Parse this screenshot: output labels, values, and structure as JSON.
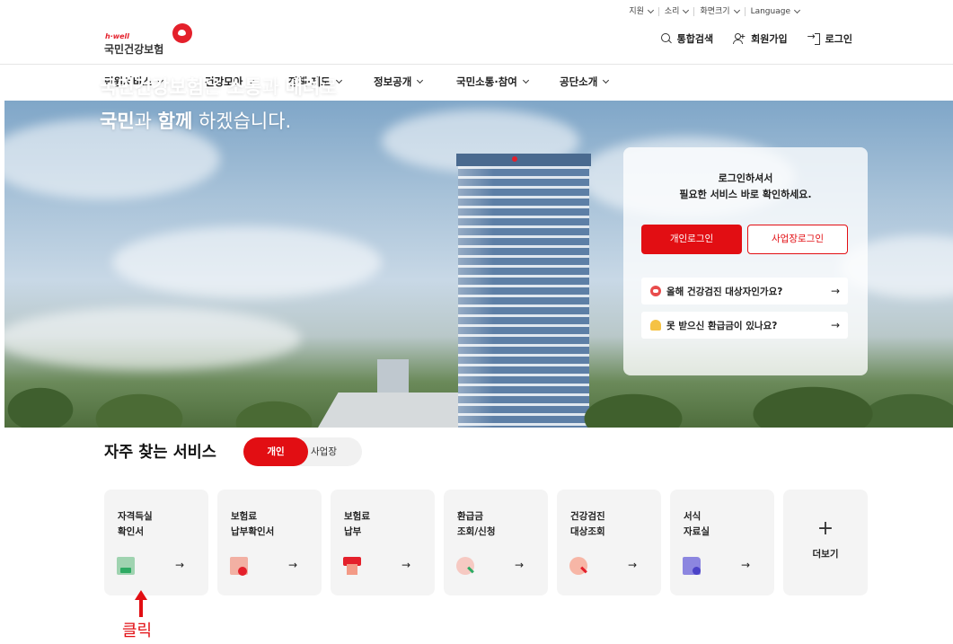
{
  "utility": {
    "items": [
      "지원",
      "소리",
      "화면크기",
      "Language"
    ]
  },
  "logo": {
    "brand": "h·well",
    "org": "국민건강보험"
  },
  "header_actions": {
    "search": "통합검색",
    "signup": "회원가입",
    "login": "로그인"
  },
  "nav": {
    "items": [
      "민원서비스",
      "건강모아",
      "정책·제도",
      "정보공개",
      "국민소통·참여",
      "공단소개"
    ]
  },
  "hero": {
    "line1": {
      "b1": "국민건강보험",
      "t1": "은 ",
      "b2": "소통",
      "t2": "과 ",
      "b3": "배려",
      "t3": "로"
    },
    "line2": {
      "b1": "국민",
      "t1": "과 ",
      "b2": "함께",
      "t2": " 하겠습니다."
    }
  },
  "login_card": {
    "message_line1": "로그인하셔서",
    "message_line2": "필요한 서비스 바로 확인하세요.",
    "personal_login": "개인로그인",
    "business_login": "사업장로그인",
    "quick_links": [
      {
        "label": "올해 건강검진 대상자인가요?",
        "icon": "heart-icon"
      },
      {
        "label": "못 받으신 환급금이 있나요?",
        "icon": "bell-icon"
      }
    ],
    "arrow": "→"
  },
  "services": {
    "title": "자주 찾는 서비스",
    "toggle": {
      "personal": "개인",
      "business": "사업장"
    },
    "cards": [
      {
        "label": "자격득실\n확인서",
        "icon": "document-icon"
      },
      {
        "label": "보험료\n납부확인서",
        "icon": "receipt-icon"
      },
      {
        "label": "보험료\n납부",
        "icon": "payment-icon"
      },
      {
        "label": "환급금\n조회/신청",
        "icon": "refund-search-icon"
      },
      {
        "label": "건강검진\n대상조회",
        "icon": "checkup-search-icon"
      },
      {
        "label": "서식\n자료실",
        "icon": "folder-download-icon"
      }
    ],
    "arrow": "→",
    "more": {
      "plus": "+",
      "label": "더보기"
    }
  },
  "annotation": {
    "label": "클릭"
  },
  "colors": {
    "accent": "#e20e13",
    "card_bg": "#f4f4f4"
  }
}
